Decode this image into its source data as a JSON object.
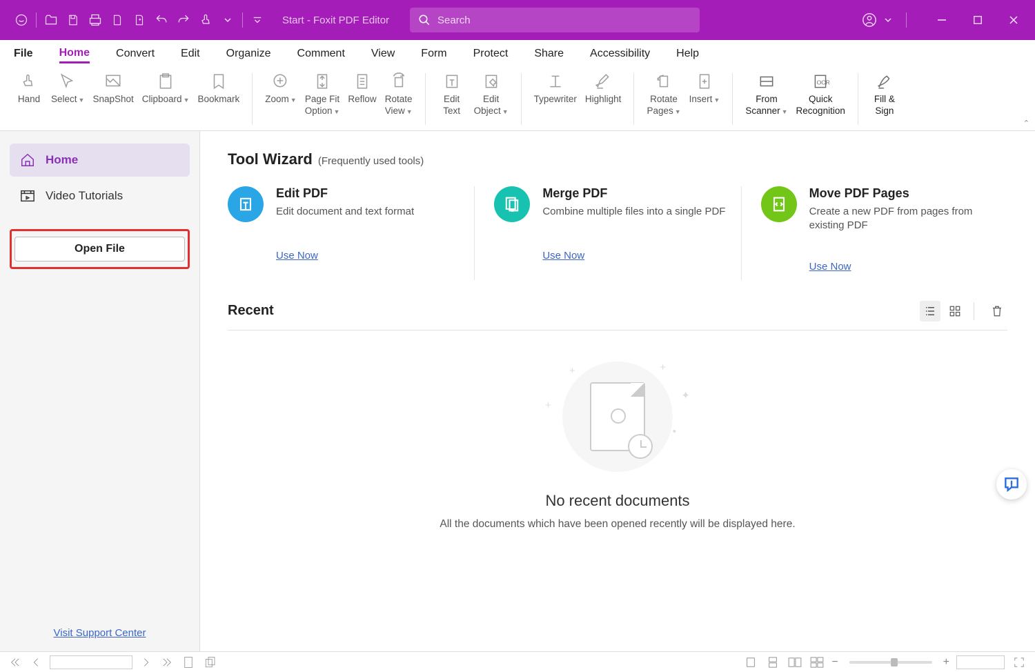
{
  "titlebar": {
    "app_title": "Start - Foxit PDF Editor",
    "search_placeholder": "Search"
  },
  "menu": {
    "items": [
      "File",
      "Home",
      "Convert",
      "Edit",
      "Organize",
      "Comment",
      "View",
      "Form",
      "Protect",
      "Share",
      "Accessibility",
      "Help"
    ],
    "active_index": 1
  },
  "ribbon": {
    "buttons": [
      {
        "label": "Hand"
      },
      {
        "label": "Select",
        "drop": true
      },
      {
        "label": "SnapShot"
      },
      {
        "label": "Clipboard",
        "drop": true
      },
      {
        "label": "Bookmark"
      },
      {
        "sep": true
      },
      {
        "label": "Zoom",
        "drop": true
      },
      {
        "label": "Page Fit Option",
        "drop": true
      },
      {
        "label": "Reflow"
      },
      {
        "label": "Rotate View",
        "drop": true
      },
      {
        "sep": true
      },
      {
        "label": "Edit Text"
      },
      {
        "label": "Edit Object",
        "drop": true
      },
      {
        "sep": true
      },
      {
        "label": "Typewriter"
      },
      {
        "label": "Highlight"
      },
      {
        "sep": true
      },
      {
        "label": "Rotate Pages",
        "drop": true
      },
      {
        "label": "Insert",
        "drop": true
      },
      {
        "sep": true
      },
      {
        "label": "From Scanner",
        "drop": true,
        "dark": true
      },
      {
        "label": "Quick Recognition",
        "dark": true
      },
      {
        "sep": true
      },
      {
        "label": "Fill & Sign",
        "dark": true
      }
    ]
  },
  "sidebar": {
    "items": [
      {
        "label": "Home",
        "active": true
      },
      {
        "label": "Video Tutorials",
        "active": false
      }
    ],
    "open_label": "Open File",
    "support_link": "Visit Support Center"
  },
  "tool_wizard": {
    "heading": "Tool Wizard",
    "subheading": "(Frequently used tools)",
    "cards": [
      {
        "title": "Edit PDF",
        "desc": "Edit document and text format",
        "link": "Use Now",
        "color": "blue"
      },
      {
        "title": "Merge PDF",
        "desc": "Combine multiple files into a single PDF",
        "link": "Use Now",
        "color": "teal"
      },
      {
        "title": "Move PDF Pages",
        "desc": "Create a new PDF from pages from existing PDF",
        "link": "Use Now",
        "color": "green"
      }
    ]
  },
  "recent": {
    "heading": "Recent",
    "empty_title": "No recent documents",
    "empty_sub": "All the documents which have been opened recently will be displayed here."
  },
  "statusbar": {
    "zoom_minus": "−",
    "zoom_plus": "+"
  }
}
